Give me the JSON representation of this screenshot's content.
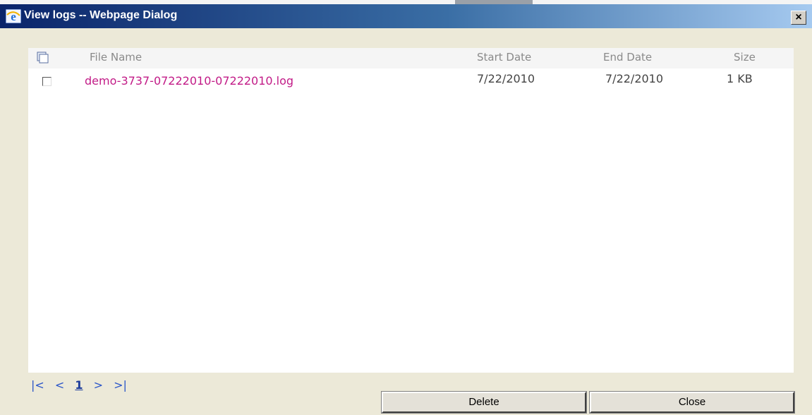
{
  "window": {
    "title": "View logs -- Webpage Dialog",
    "close_glyph": "×",
    "app_icon": "ie-icon",
    "close_icon": "close-icon"
  },
  "table": {
    "select_all_icon": "select-all-icon",
    "columns": {
      "file_name": "File Name",
      "start_date": "Start Date",
      "end_date": "End Date",
      "size": "Size"
    },
    "rows": [
      {
        "file_name": "demo-3737-07222010-07222010.log",
        "start_date": "7/22/2010",
        "end_date": "7/22/2010",
        "size": "1 KB",
        "checked": false
      }
    ]
  },
  "pager": {
    "first": "|<",
    "prev": "<",
    "current": "1",
    "next": ">",
    "last": ">|"
  },
  "buttons": {
    "delete": "Delete",
    "close": "Close"
  },
  "colors": {
    "title_gradient_start": "#0a246a",
    "title_gradient_end": "#a6caf0",
    "link": "#c21b87",
    "pager": "#2a55c8",
    "dialog_bg": "#ece9d8"
  }
}
